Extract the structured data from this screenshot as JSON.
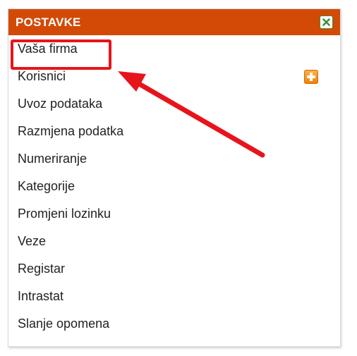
{
  "panel": {
    "title": "POSTAVKE",
    "header_color": "#d24a06",
    "close_icon": "close-icon"
  },
  "menu": {
    "items": [
      {
        "label": "Vaša firma"
      },
      {
        "label": "Korisnici",
        "action_icon": "add-icon"
      },
      {
        "label": "Uvoz podataka"
      },
      {
        "label": "Razmjena podatka"
      },
      {
        "label": "Numeriranje"
      },
      {
        "label": "Kategorije"
      },
      {
        "label": "Promjeni lozinku"
      },
      {
        "label": "Veze"
      },
      {
        "label": "Registar"
      },
      {
        "label": "Intrastat"
      },
      {
        "label": "Slanje opomena"
      }
    ]
  },
  "annotation": {
    "color": "#e8141b",
    "highlighted_item": "Vaša firma"
  }
}
